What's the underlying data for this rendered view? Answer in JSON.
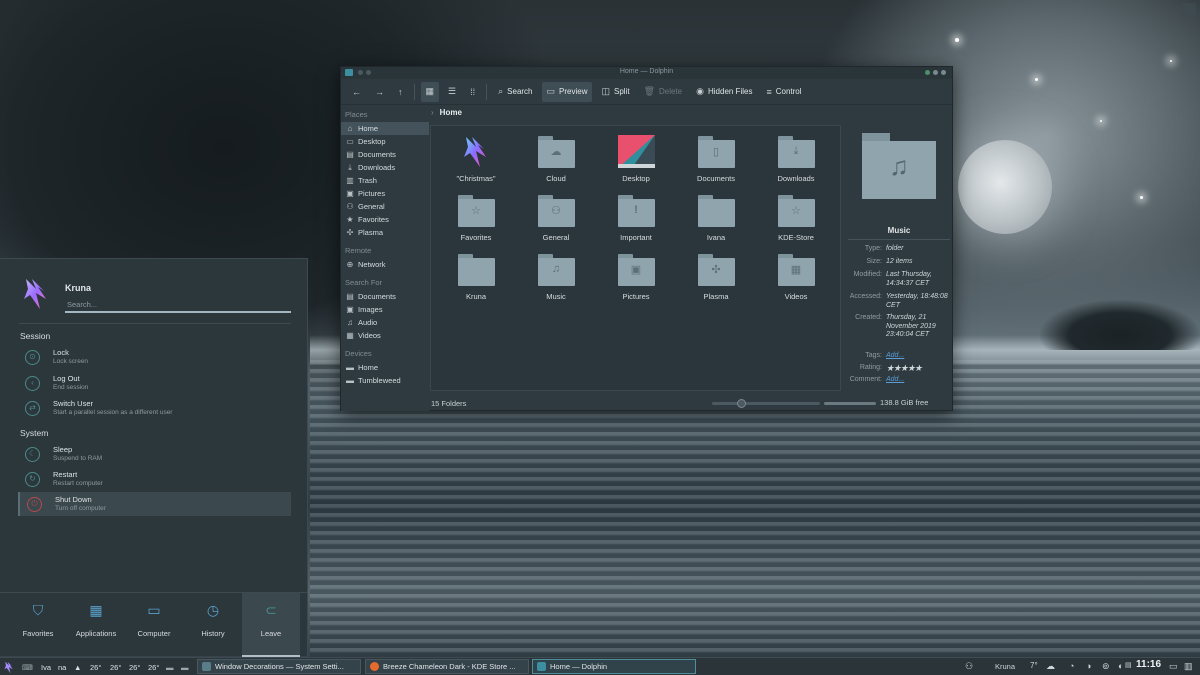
{
  "dolphin": {
    "title": "Home — Dolphin",
    "toolbar": {
      "search": "Search",
      "preview": "Preview",
      "split": "Split",
      "delete": "Delete",
      "hidden_files": "Hidden Files",
      "control": "Control"
    },
    "sidebar": {
      "places_header": "Places",
      "places": [
        "Home",
        "Desktop",
        "Documents",
        "Downloads",
        "Trash",
        "Pictures",
        "General",
        "Favorites",
        "Plasma"
      ],
      "remote_header": "Remote",
      "remote": [
        "Network"
      ],
      "searchfor_header": "Search For",
      "searchfor": [
        "Documents",
        "Images",
        "Audio",
        "Videos"
      ],
      "devices_header": "Devices",
      "devices": [
        "Home",
        "Tumbleweed"
      ]
    },
    "breadcrumb": "Home",
    "files": [
      "\"Christmas\"",
      "Cloud",
      "Desktop",
      "Documents",
      "Downloads",
      "Favorites",
      "General",
      "Important",
      "Ivana",
      "KDE-Store",
      "Kruna",
      "Music",
      "Pictures",
      "Plasma",
      "Videos"
    ],
    "status": {
      "folders": "15 Folders",
      "free": "138.8 GiB free"
    },
    "info": {
      "name": "Music",
      "type_k": "Type:",
      "type_v": "folder",
      "size_k": "Size:",
      "size_v": "12 items",
      "modified_k": "Modified:",
      "modified_v": "Last Thursday, 14:34:37 CET",
      "accessed_k": "Accessed:",
      "accessed_v": "Yesterday, 18:48:08 CET",
      "created_k": "Created:",
      "created_v": "Thursday, 21 November 2019 23:40:04 CET",
      "tags_k": "Tags:",
      "tags_v": "Add...",
      "rating_k": "Rating:",
      "rating_v": "★★★★★",
      "comment_k": "Comment:",
      "comment_v": "Add..."
    }
  },
  "launcher": {
    "user": "Kruna",
    "search_placeholder": "Search...",
    "session_header": "Session",
    "system_header": "System",
    "session": [
      {
        "title": "Lock",
        "sub": "Lock screen"
      },
      {
        "title": "Log Out",
        "sub": "End session"
      },
      {
        "title": "Switch User",
        "sub": "Start a parallel session as a different user"
      }
    ],
    "system": [
      {
        "title": "Sleep",
        "sub": "Suspend to RAM"
      },
      {
        "title": "Restart",
        "sub": "Restart computer"
      },
      {
        "title": "Shut Down",
        "sub": "Turn off computer"
      }
    ],
    "tabs": [
      "Favorites",
      "Applications",
      "Computer",
      "History",
      "Leave"
    ]
  },
  "taskbar": {
    "pager1": "Iva",
    "pager2": "na",
    "temps": [
      "26°",
      "26°",
      "26°",
      "26°"
    ],
    "tasks": [
      "Window Decorations — System Setti...",
      "Breeze Chameleon Dark - KDE Store ...",
      "Home — Dolphin"
    ],
    "user": "Kruna",
    "weather": "7°",
    "clock": "11:16"
  },
  "colors": {
    "accent": "#4f8c9c",
    "folder": "#90a4ae",
    "link": "#5b9fd6"
  }
}
